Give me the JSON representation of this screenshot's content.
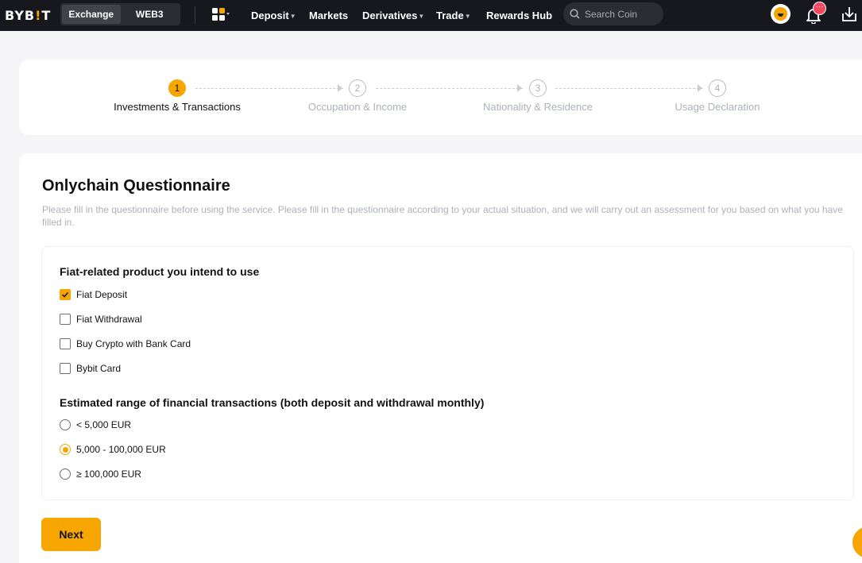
{
  "brand": {
    "logo_pre": "BYB",
    "logo_bang": "!",
    "logo_post": "T"
  },
  "topbar": {
    "segment": [
      "Exchange",
      "WEB3"
    ],
    "nav": [
      "Deposit",
      "Markets",
      "Derivatives",
      "Trade",
      "Rewards Hub"
    ],
    "search_placeholder": "Search Coin",
    "badge": "···"
  },
  "steps": [
    {
      "num": "1",
      "label": "Investments & Transactions",
      "active": true
    },
    {
      "num": "2",
      "label": "Occupation & Income",
      "active": false
    },
    {
      "num": "3",
      "label": "Nationality & Residence",
      "active": false
    },
    {
      "num": "4",
      "label": "Usage Declaration",
      "active": false
    }
  ],
  "form": {
    "title": "Onlychain Questionnaire",
    "description": "Please fill in the questionnaire before using the service. Please fill in the questionnaire according to your actual situation, and we will carry out an assessment for you based on what you have filled in.",
    "q1": {
      "label": "Fiat-related product you intend to use",
      "options": [
        {
          "label": "Fiat Deposit",
          "checked": true
        },
        {
          "label": "Fiat Withdrawal",
          "checked": false
        },
        {
          "label": "Buy Crypto with Bank Card",
          "checked": false
        },
        {
          "label": "Bybit Card",
          "checked": false
        }
      ]
    },
    "q2": {
      "label": "Estimated range of financial transactions (both deposit and withdrawal monthly)",
      "options": [
        {
          "label": "< 5,000 EUR",
          "selected": false
        },
        {
          "label": "5,000 - 100,000 EUR",
          "selected": true
        },
        {
          "label": "≥ 100,000 EUR",
          "selected": false
        }
      ]
    },
    "next_label": "Next"
  },
  "colors": {
    "accent": "#f7a600",
    "topbar": "#17181e",
    "muted": "#adb1b8"
  }
}
